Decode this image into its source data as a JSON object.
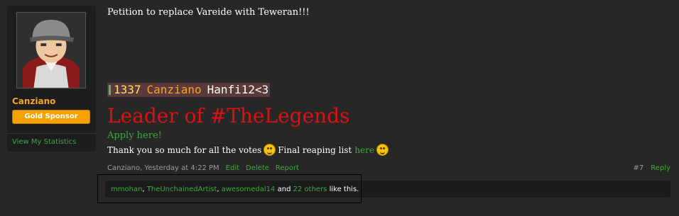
{
  "user": {
    "name": "Canziano",
    "badge": "Gold Sponsor",
    "stats_link": "View My Statistics"
  },
  "post": {
    "message": "Petition to replace Vareide with Teweran!!!",
    "signature": {
      "mc_level": "1337",
      "mc_name": "Canziano",
      "mc_tag": "Hanfi12<3",
      "leader": "Leader of #TheLegends",
      "apply": "Apply here!",
      "thanks_text": "Thank you so much for all the votes",
      "reaping_text": "Final reaping list",
      "reaping_link": "here"
    },
    "meta": {
      "author": "Canziano",
      "time": "Yesterday at 4:22 PM",
      "edit": "Edit",
      "delete": "Delete",
      "report": "Report",
      "number": "#7",
      "reply": "Reply"
    },
    "likes": {
      "user1": "mmohan",
      "user2": "TheUnchainedArtist",
      "user3": "awesomedal14",
      "and": "and",
      "others": "22 others",
      "suffix": "like this."
    }
  },
  "colors": {
    "accent_green": "#3ea83e",
    "username_orange": "#f5a623",
    "leader_red": "#e01010"
  }
}
